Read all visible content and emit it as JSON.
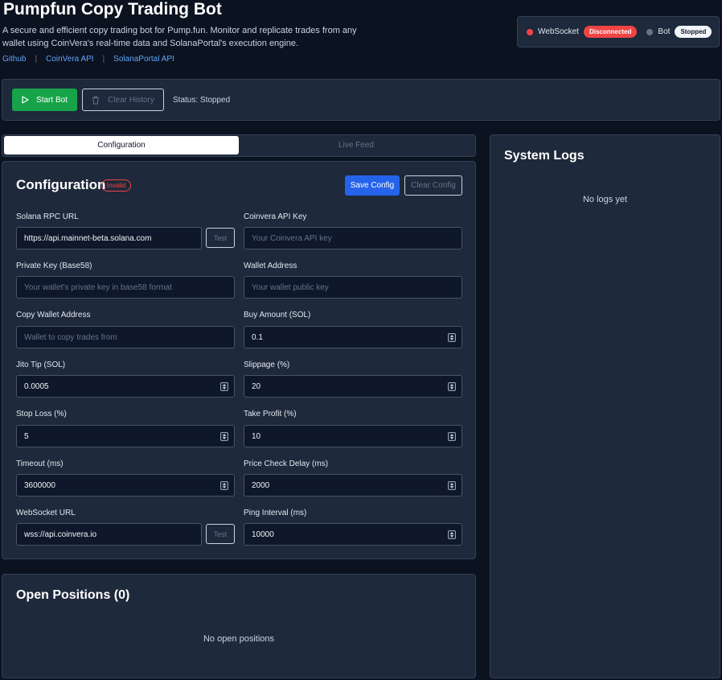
{
  "header": {
    "title": "Pumpfun Copy Trading Bot",
    "description": "A secure and efficient copy trading bot for Pump.fun. Monitor and replicate trades from any wallet using CoinVera's real-time data and SolanaPortal's execution engine.",
    "links": [
      {
        "label": "Github"
      },
      {
        "label": "CoinVera API"
      },
      {
        "label": "SolanaPortal API"
      }
    ],
    "link_separator": "|"
  },
  "status": {
    "websocket_label": "WebSocket",
    "websocket_state": "Disconnected",
    "bot_label": "Bot",
    "bot_state": "Stopped",
    "colors": {
      "disconnected": "#ef4444",
      "bot_dot": "#6b7280"
    }
  },
  "controls": {
    "start_label": "Start Bot",
    "clear_history_label": "Clear History",
    "status_text": "Status: Stopped"
  },
  "tabs": [
    {
      "label": "Configuration",
      "active": true
    },
    {
      "label": "Live Feed",
      "active": false
    }
  ],
  "config": {
    "title": "Configuration",
    "validity_badge": "Invalid",
    "save_label": "Save Config",
    "clear_label": "Clear Config",
    "test_label": "Test",
    "fields": {
      "rpc_url": {
        "label": "Solana RPC URL",
        "value": "https://api.mainnet-beta.solana.com",
        "placeholder": ""
      },
      "coinvera_key": {
        "label": "Coinvera API Key",
        "value": "",
        "placeholder": "Your Coinvera API key"
      },
      "private_key": {
        "label": "Private Key (Base58)",
        "value": "",
        "placeholder": "Your wallet's private key in base58 format"
      },
      "wallet_address": {
        "label": "Wallet Address",
        "value": "",
        "placeholder": "Your wallet public key"
      },
      "copy_wallet": {
        "label": "Copy Wallet Address",
        "value": "",
        "placeholder": "Wallet to copy trades from"
      },
      "buy_amount": {
        "label": "Buy Amount (SOL)",
        "value": "0.1"
      },
      "jito_tip": {
        "label": "Jito Tip (SOL)",
        "value": "0.0005"
      },
      "slippage": {
        "label": "Slippage (%)",
        "value": "20"
      },
      "stop_loss": {
        "label": "Stop Loss (%)",
        "value": "5"
      },
      "take_profit": {
        "label": "Take Profit (%)",
        "value": "10"
      },
      "timeout": {
        "label": "Timeout (ms)",
        "value": "3600000"
      },
      "price_check_delay": {
        "label": "Price Check Delay (ms)",
        "value": "2000"
      },
      "websocket_url": {
        "label": "WebSocket URL",
        "value": "wss://api.coinvera.io"
      },
      "ping_interval": {
        "label": "Ping Interval (ms)",
        "value": "10000"
      }
    }
  },
  "positions": {
    "title": "Open Positions (0)",
    "empty_text": "No open positions"
  },
  "logs": {
    "title": "System Logs",
    "empty_text": "No logs yet"
  },
  "theme": {
    "background": "#0b1220",
    "panel": "#1e293b",
    "accent_green": "#16a34a",
    "accent_blue": "#2563eb",
    "danger": "#ef4444",
    "link": "#60a5fa"
  }
}
